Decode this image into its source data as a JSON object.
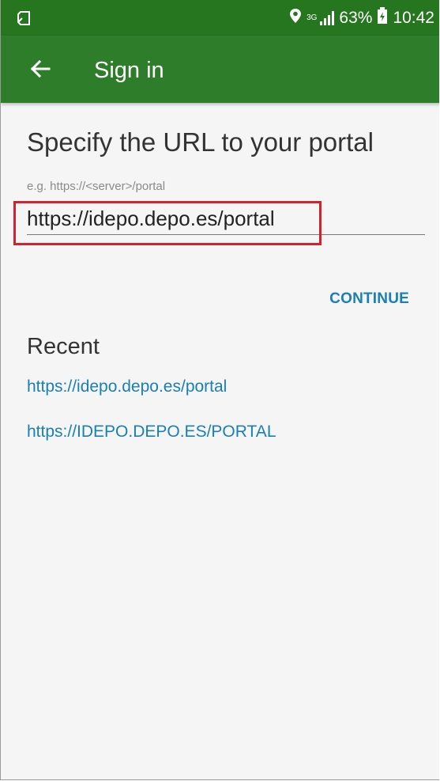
{
  "status_bar": {
    "battery": "63%",
    "time": "10:42",
    "network_type": "3G",
    "icons": [
      "screen-rotate-icon",
      "location-icon",
      "signal-icon",
      "battery-icon"
    ]
  },
  "app_bar": {
    "title": "Sign in",
    "back_icon": "arrow-left-icon",
    "color": "#2e7d2a"
  },
  "form": {
    "heading": "Specify the URL to your portal",
    "hint": "e.g. https://<server>/portal",
    "url_value": "https://idepo.depo.es/portal",
    "continue_label": "CONTINUE"
  },
  "recent": {
    "heading": "Recent",
    "items": [
      "https://idepo.depo.es/portal",
      "https://IDEPO.DEPO.ES/PORTAL"
    ]
  },
  "colors": {
    "accent": "#1a7fb5",
    "highlight": "#d3222d"
  }
}
